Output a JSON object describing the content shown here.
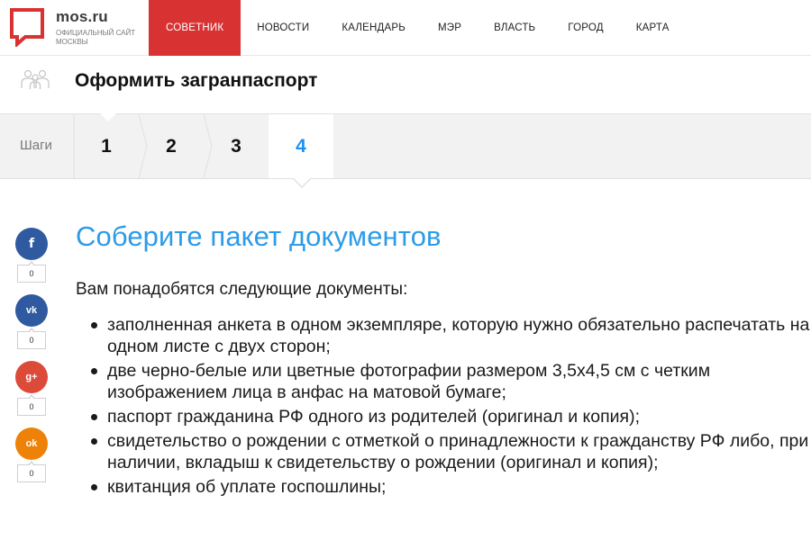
{
  "header": {
    "logo_name": "mos.ru",
    "logo_sub": "официальный сайт москвы",
    "nav": [
      {
        "label": "СОВЕТНИК",
        "active": true
      },
      {
        "label": "НОВОСТИ",
        "active": false
      },
      {
        "label": "КАЛЕНДАРЬ",
        "active": false
      },
      {
        "label": "МЭР",
        "active": false
      },
      {
        "label": "ВЛАСТЬ",
        "active": false
      },
      {
        "label": "ГОРОД",
        "active": false
      },
      {
        "label": "КАРТА",
        "active": false
      }
    ],
    "accent_color": "#d83232"
  },
  "page": {
    "title": "Оформить загранпаспорт",
    "icon": "people-icon"
  },
  "steps": {
    "label": "Шаги",
    "items": [
      "1",
      "2",
      "3",
      "4"
    ],
    "active": "4",
    "active_color": "#1e90ee"
  },
  "social": [
    {
      "network": "facebook",
      "icon": "facebook-icon",
      "glyph": "f",
      "color": "#2f5aa0",
      "count": "0"
    },
    {
      "network": "vkontakte",
      "icon": "vk-icon",
      "glyph": "vk",
      "color": "#2f5aa0",
      "count": "0"
    },
    {
      "network": "google-plus",
      "icon": "google-plus-icon",
      "glyph": "g+",
      "color": "#dc4a3a",
      "count": "0"
    },
    {
      "network": "odnoklassniki",
      "icon": "odnoklassniki-icon",
      "glyph": "ok",
      "color": "#ee8208",
      "count": "0"
    }
  ],
  "content": {
    "section_title": "Соберите пакет документов",
    "intro": "Вам понадобятся следующие документы:",
    "documents": [
      "заполненная анкета в одном экземпляре, которую нужно обязательно распечатать на одном листе с двух сторон;",
      "две черно-белые или цветные фотографии размером 3,5x4,5 см с четким изображением лица в анфас на матовой бумаге;",
      "паспорт гражданина РФ одного из родителей (оригинал и копия);",
      "свидетельство о рождении с отметкой о принадлежности к гражданству РФ либо, при наличии, вкладыш к свидетельству о рождении (оригинал и копия);",
      "квитанция об уплате госпошлины;"
    ],
    "title_color": "#2c9be8"
  }
}
